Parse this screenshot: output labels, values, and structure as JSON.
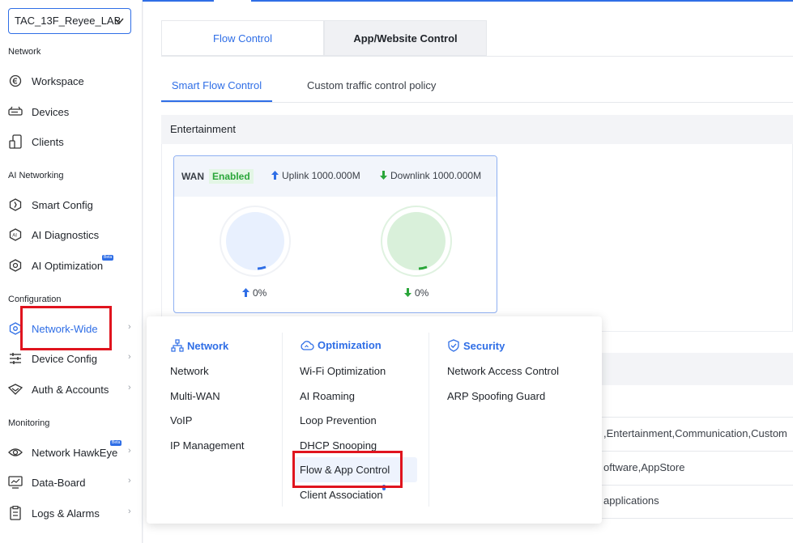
{
  "site_selector": {
    "value": "TAC_13F_Reyee_LAB"
  },
  "sidebar": {
    "sections": [
      {
        "label": "Network"
      },
      {
        "label": "AI Networking"
      },
      {
        "label": "Configuration"
      },
      {
        "label": "Monitoring"
      }
    ],
    "items": [
      {
        "label": "Workspace",
        "icon": "workspace-icon"
      },
      {
        "label": "Devices",
        "icon": "devices-icon"
      },
      {
        "label": "Clients",
        "icon": "clients-icon"
      },
      {
        "label": "Smart Config",
        "icon": "smart-config-icon"
      },
      {
        "label": "AI Diagnostics",
        "icon": "ai-diagnostics-icon"
      },
      {
        "label": "AI Optimization",
        "icon": "ai-optimization-icon",
        "badge": "Beta"
      },
      {
        "label": "Network-Wide",
        "icon": "network-wide-icon",
        "active": true
      },
      {
        "label": "Device Config",
        "icon": "device-config-icon"
      },
      {
        "label": "Auth & Accounts",
        "icon": "auth-accounts-icon"
      },
      {
        "label": "Network HawkEye",
        "icon": "hawkeye-icon",
        "badge": "Beta"
      },
      {
        "label": "Data-Board",
        "icon": "data-board-icon"
      },
      {
        "label": "Logs & Alarms",
        "icon": "logs-alarms-icon"
      }
    ]
  },
  "main": {
    "tabs": [
      {
        "label": "Flow Control",
        "active": true
      },
      {
        "label": "App/Website Control",
        "active": false
      }
    ],
    "subtabs": [
      {
        "label": "Smart Flow Control",
        "active": true
      },
      {
        "label": "Custom traffic control policy",
        "active": false
      }
    ],
    "section_title": "Entertainment",
    "wan_card": {
      "title": "WAN",
      "status": "Enabled",
      "uplink": "Uplink 1000.000M",
      "downlink": "Downlink 1000.000M",
      "uplink_value": "0%",
      "downlink_value": "0%"
    },
    "table_rows": [
      {
        "text": ",Entertainment,Communication,Custom"
      },
      {
        "text": "oftware,AppStore"
      },
      {
        "text": "applications"
      }
    ]
  },
  "dropdown": {
    "columns": [
      {
        "title": "Network",
        "icon": "network-topology-icon",
        "items": [
          "Network",
          "Multi-WAN",
          "VoIP",
          "IP Management"
        ]
      },
      {
        "title": "Optimization",
        "icon": "cloud-icon",
        "items": [
          "Wi-Fi Optimization",
          "AI Roaming",
          "Loop Prevention",
          "DHCP Snooping",
          "Flow & App Control",
          "Client Association"
        ]
      },
      {
        "title": "Security",
        "icon": "shield-check-icon",
        "items": [
          "Network Access Control",
          "ARP Spoofing Guard"
        ]
      }
    ]
  },
  "colors": {
    "accent": "#2f6ee6",
    "highlight": "#e0141e",
    "enabled": "#2aa63a"
  }
}
